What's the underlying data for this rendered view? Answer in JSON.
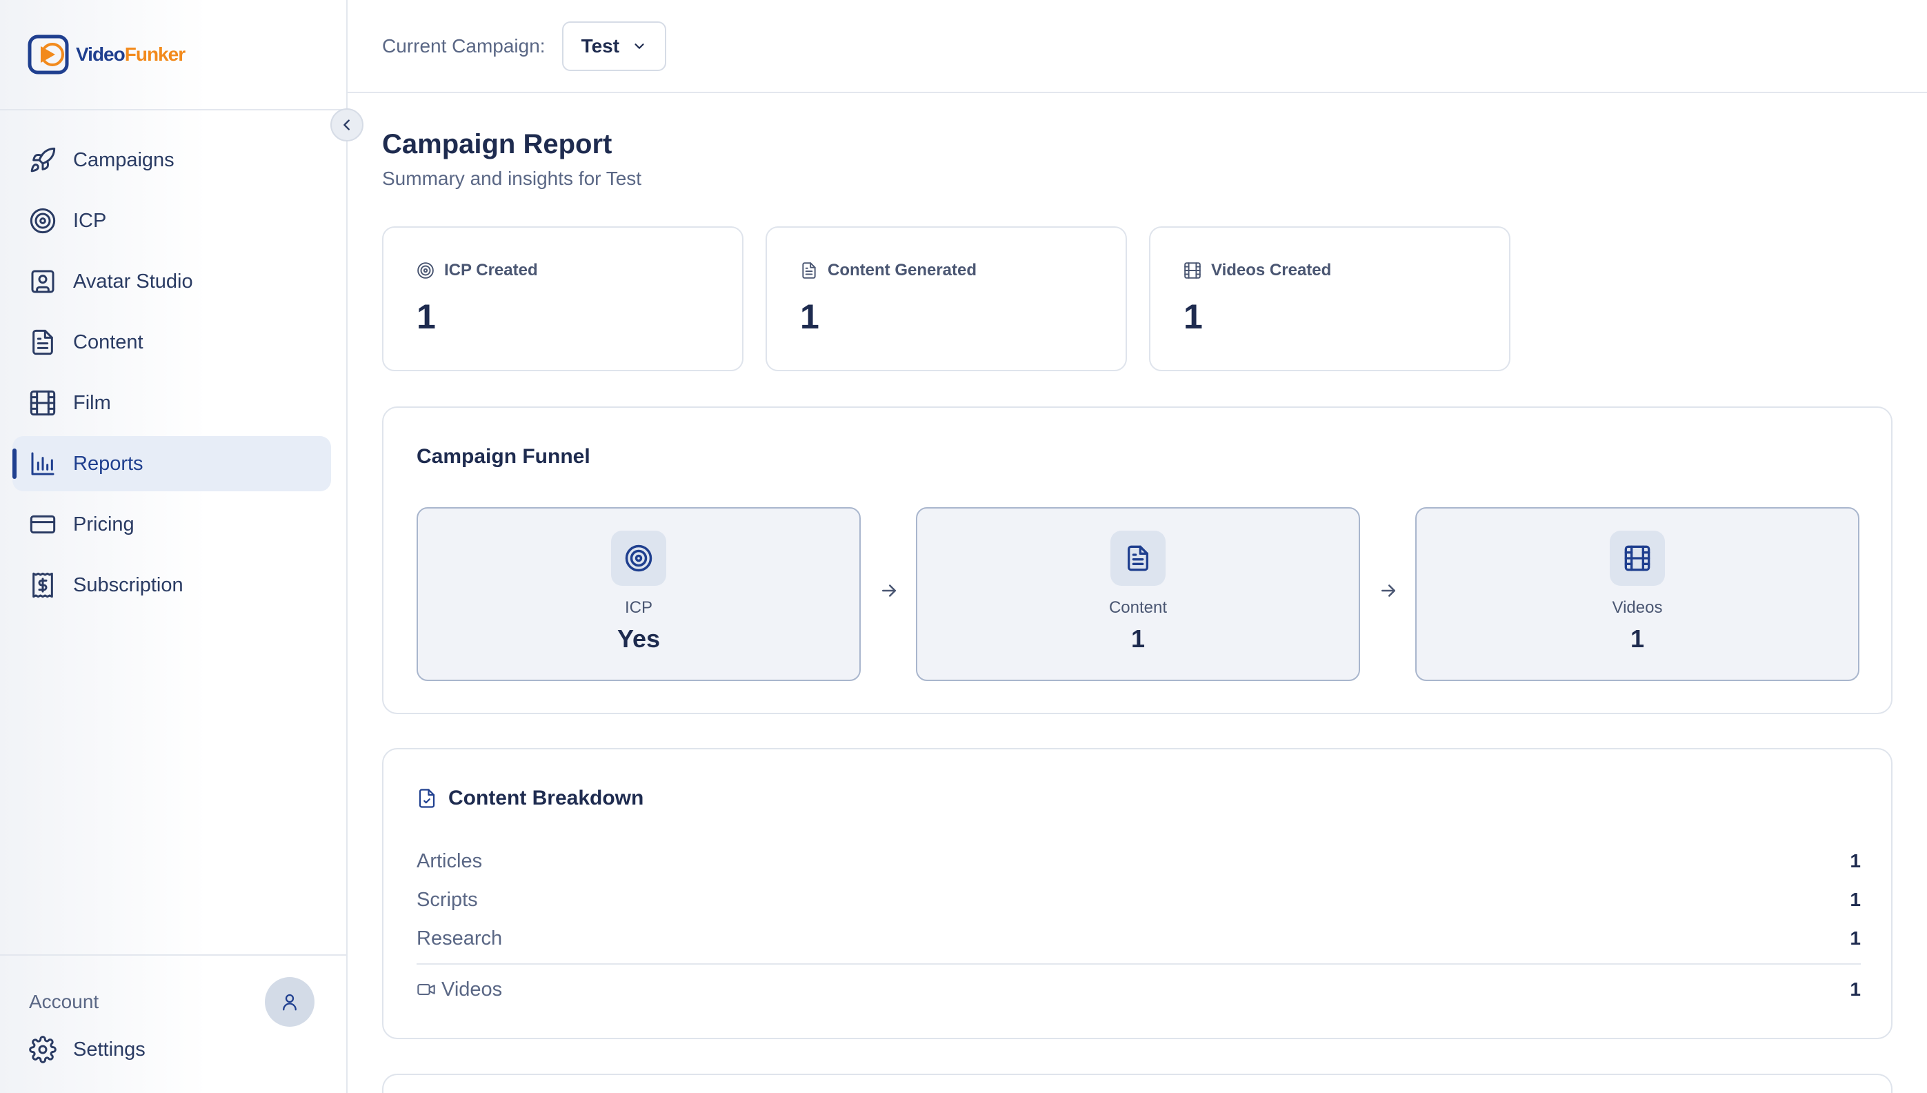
{
  "brand": {
    "name_part1": "Video",
    "name_part2": "Funker",
    "accent": "#1f3f8f",
    "accent2": "#f28a1c"
  },
  "sidebar": {
    "items": [
      {
        "label": "Campaigns",
        "icon": "rocket-icon",
        "active": false
      },
      {
        "label": "ICP",
        "icon": "target-icon",
        "active": false
      },
      {
        "label": "Avatar Studio",
        "icon": "user-square-icon",
        "active": false
      },
      {
        "label": "Content",
        "icon": "file-text-icon",
        "active": false
      },
      {
        "label": "Film",
        "icon": "film-icon",
        "active": false
      },
      {
        "label": "Reports",
        "icon": "bar-chart-icon",
        "active": true
      },
      {
        "label": "Pricing",
        "icon": "credit-card-icon",
        "active": false
      },
      {
        "label": "Subscription",
        "icon": "receipt-dollar-icon",
        "active": false
      }
    ],
    "account_label": "Account",
    "settings_label": "Settings"
  },
  "header": {
    "campaign_label": "Current Campaign:",
    "campaign_value": "Test"
  },
  "page": {
    "title": "Campaign Report",
    "subtitle": "Summary and insights for Test"
  },
  "stats": [
    {
      "label": "ICP Created",
      "value": "1",
      "icon": "target-icon"
    },
    {
      "label": "Content Generated",
      "value": "1",
      "icon": "file-text-icon"
    },
    {
      "label": "Videos Created",
      "value": "1",
      "icon": "film-icon"
    }
  ],
  "funnel": {
    "title": "Campaign Funnel",
    "steps": [
      {
        "label": "ICP",
        "value": "Yes",
        "icon": "target-icon"
      },
      {
        "label": "Content",
        "value": "1",
        "icon": "file-text-icon"
      },
      {
        "label": "Videos",
        "value": "1",
        "icon": "film-icon"
      }
    ]
  },
  "breakdown": {
    "title": "Content Breakdown",
    "rows": [
      {
        "label": "Articles",
        "value": "1"
      },
      {
        "label": "Scripts",
        "value": "1"
      },
      {
        "label": "Research",
        "value": "1"
      }
    ],
    "videos": {
      "label": "Videos",
      "value": "1",
      "icon": "video-icon"
    }
  }
}
